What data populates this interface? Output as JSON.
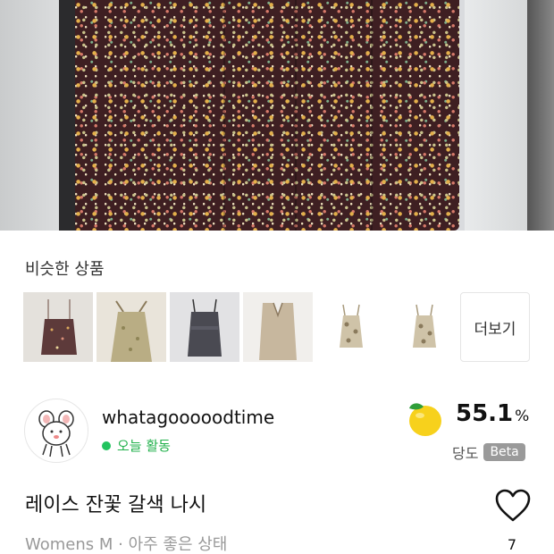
{
  "hero": {
    "image_desc_name": "product-photo"
  },
  "similar": {
    "title": "비슷한 상품",
    "more_label": "더보기",
    "items": [
      {
        "name": "similar-item-1"
      },
      {
        "name": "similar-item-2"
      },
      {
        "name": "similar-item-3"
      },
      {
        "name": "similar-item-4"
      },
      {
        "name": "similar-item-5"
      },
      {
        "name": "similar-item-6"
      }
    ]
  },
  "seller": {
    "name": "whatagooooodtime",
    "status": "오늘 활동",
    "status_color": "#22c35e"
  },
  "score": {
    "value": "55.1",
    "unit": "%",
    "label": "당도",
    "badge": "Beta",
    "icon": "lemon-icon"
  },
  "product": {
    "title": "레이스 잔꽃 갈색 나시",
    "meta": "Womens M · 아주 좋은 상태",
    "like_count": "7",
    "like_icon": "heart-outline-icon"
  }
}
